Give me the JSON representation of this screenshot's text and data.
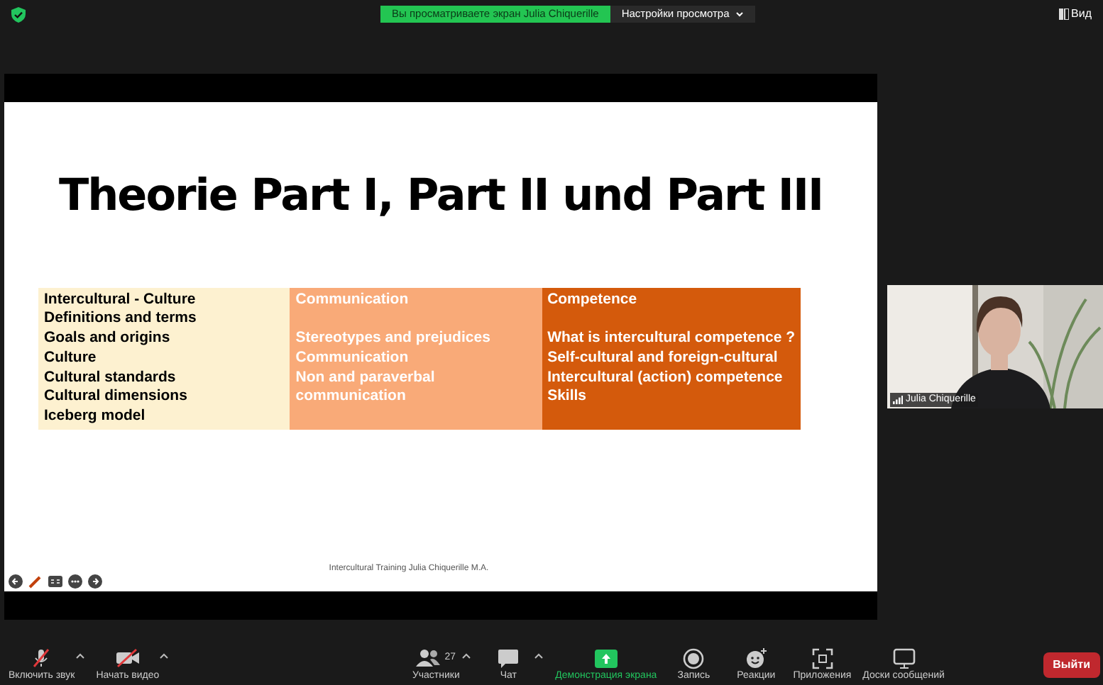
{
  "top_bar": {
    "sharing_banner": "Вы просматриваете экран Julia Chiquerille",
    "view_options": "Настройки просмотра",
    "view_button": "Вид"
  },
  "slide": {
    "title": "Theorie Part I, Part II und Part III",
    "columns": [
      {
        "color": "#fdf1d0",
        "dark_text": true,
        "blocks": [
          [
            "Intercultural - Culture",
            "Definitions and terms",
            "Goals and origins",
            "Culture",
            "Cultural standards",
            "Cultural dimensions",
            "Iceberg model"
          ]
        ]
      },
      {
        "color": "#f9aa78",
        "dark_text": false,
        "blocks": [
          [
            "Communication"
          ],
          [
            "Stereotypes and prejudices",
            "Communication",
            "Non and paraverbal",
            "communication"
          ]
        ]
      },
      {
        "color": "#d45a0c",
        "dark_text": false,
        "blocks": [
          [
            "Competence"
          ],
          [
            "What is intercultural competence ?",
            "Self-cultural and foreign-cultural",
            "Intercultural (action) competence",
            "Skills"
          ]
        ]
      }
    ],
    "footer": "Intercultural Training Julia Chiquerille M.A."
  },
  "video": {
    "name": "Julia Chiquerille"
  },
  "toolbar": [
    {
      "kind": "mic",
      "label": "Включить звук",
      "caret": true
    },
    {
      "kind": "video",
      "label": "Начать видео",
      "caret": true
    },
    {
      "kind": "participants",
      "label": "Участники",
      "count": "27",
      "caret": true
    },
    {
      "kind": "chat",
      "label": "Чат",
      "caret": true
    },
    {
      "kind": "share",
      "label": "Демонстрация экрана",
      "caret": false
    },
    {
      "kind": "record",
      "label": "Запись",
      "caret": false
    },
    {
      "kind": "reactions",
      "label": "Реакции",
      "caret": false
    },
    {
      "kind": "apps",
      "label": "Приложения",
      "caret": false
    },
    {
      "kind": "whiteboard",
      "label": "Доски сообщений",
      "caret": false
    }
  ],
  "leave_button": "Выйти"
}
